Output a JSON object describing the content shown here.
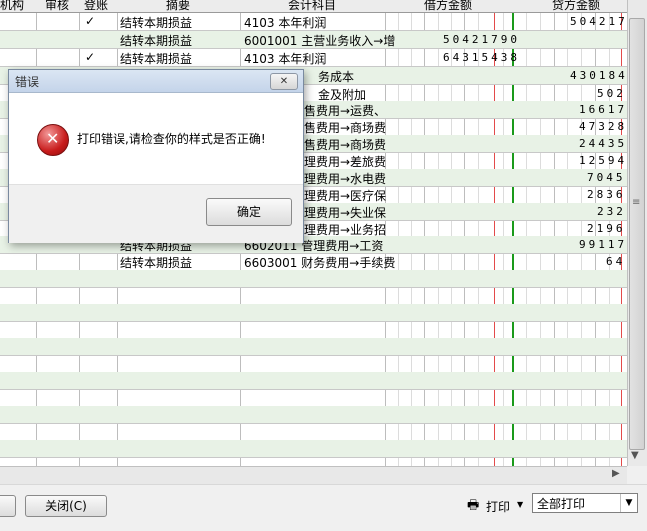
{
  "grid": {
    "headers": [
      "机构",
      "审核",
      "登账",
      "摘要",
      "会计科目",
      "借方金额",
      "贷方金额"
    ],
    "rows": [
      {
        "check": "✓",
        "summary": "结转本期损益",
        "account": "4103  本年利润",
        "debit": "",
        "credit": "504217"
      },
      {
        "check": "",
        "summary": "结转本期损益",
        "account": "6001001  主营业务收入→增",
        "debit": "50421790",
        "credit": ""
      },
      {
        "check": "✓",
        "summary": "结转本期损益",
        "account": "4103  本年利润",
        "debit": "64315438",
        "credit": ""
      },
      {
        "check": "",
        "summary": "",
        "account": "务成本",
        "debit": "",
        "credit": "430184"
      },
      {
        "check": "",
        "summary": "",
        "account": "金及附加",
        "debit": "",
        "credit": "502"
      },
      {
        "check": "",
        "summary": "",
        "account": "售费用→运费、",
        "debit": "",
        "credit": "16617"
      },
      {
        "check": "",
        "summary": "",
        "account": "售费用→商场费",
        "debit": "",
        "credit": "47328"
      },
      {
        "check": "",
        "summary": "",
        "account": "售费用→商场费",
        "debit": "",
        "credit": "24435"
      },
      {
        "check": "",
        "summary": "",
        "account": "理费用→差旅费",
        "debit": "",
        "credit": "12594"
      },
      {
        "check": "",
        "summary": "",
        "account": "理费用→水电费",
        "debit": "",
        "credit": "7045"
      },
      {
        "check": "",
        "summary": "",
        "account": "理费用→医疗保",
        "debit": "",
        "credit": "2836"
      },
      {
        "check": "",
        "summary": "",
        "account": "理费用→失业保",
        "debit": "",
        "credit": "232"
      },
      {
        "check": "",
        "summary": "",
        "account": "理费用→业务招",
        "debit": "",
        "credit": "2196"
      },
      {
        "check": "",
        "summary": "结转本期损益",
        "account": "6602011  管理费用→工资",
        "debit": "",
        "credit": "99117"
      },
      {
        "check": "",
        "summary": "结转本期损益",
        "account": "6603001  财务费用→手续费",
        "debit": "",
        "credit": "64"
      }
    ]
  },
  "dialog": {
    "title": "错误",
    "close_label": "✕",
    "message": "打印错误,请检查你的样式是否正确!",
    "ok_label": "确定"
  },
  "footer": {
    "close_label": "关闭(C)",
    "print_label": "打印",
    "print_scope": "全部打印"
  }
}
